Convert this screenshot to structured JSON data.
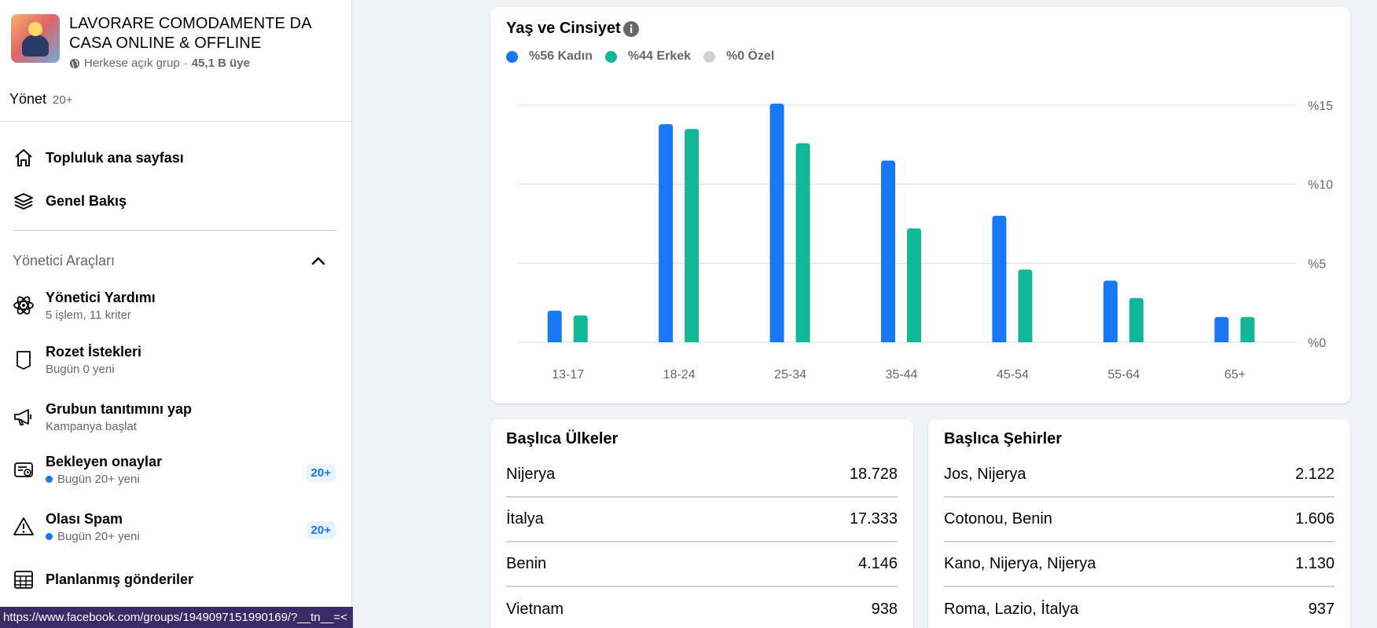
{
  "group": {
    "name": "LAVORARE COMODAMENTE DA CASA ONLINE & OFFLINE",
    "privacy": "Herkese açık grup",
    "separator": "·",
    "members": "45,1 B üye"
  },
  "manage": {
    "label": "Yönet",
    "count": "20+"
  },
  "nav": {
    "home": "Topluluk ana sayfası",
    "overview": "Genel Bakış"
  },
  "admin_tools": {
    "title": "Yönetici Araçları",
    "items": [
      {
        "title": "Yönetici Yardımı",
        "sub": "5 işlem, 11 kriter",
        "icon": "admin-assist-icon"
      },
      {
        "title": "Rozet İstekleri",
        "sub": "Bugün 0 yeni",
        "icon": "badge-icon"
      },
      {
        "title": "Grubun tanıtımını yap",
        "sub": "Kampanya başlat",
        "icon": "megaphone-icon"
      },
      {
        "title": "Bekleyen onaylar",
        "sub": "Bugün 20+ yeni",
        "badge": "20+",
        "icon": "pending-icon"
      },
      {
        "title": "Olası Spam",
        "sub": "Bugün 20+ yeni",
        "badge": "20+",
        "icon": "warning-icon"
      },
      {
        "title": "Planlanmış gönderiler",
        "icon": "calendar-icon"
      }
    ]
  },
  "status_url": "https://www.facebook.com/groups/1949097151990169/?__tn__=<",
  "chart": {
    "title": "Yaş ve Cinsiyet",
    "legend": [
      {
        "label": "%56 Kadın",
        "color": "#1877f2"
      },
      {
        "label": "%44 Erkek",
        "color": "#12b797"
      },
      {
        "label": "%0 Özel",
        "color": "#ced0d4"
      }
    ]
  },
  "chart_data": {
    "type": "bar",
    "title": "Yaş ve Cinsiyet",
    "categories": [
      "13-17",
      "18-24",
      "25-34",
      "35-44",
      "45-54",
      "55-64",
      "65+"
    ],
    "series": [
      {
        "name": "%56 Kadın",
        "color": "#1877f2",
        "values": [
          2.0,
          13.8,
          15.1,
          11.5,
          8.0,
          3.9,
          1.6
        ]
      },
      {
        "name": "%44 Erkek",
        "color": "#12b797",
        "values": [
          1.7,
          13.5,
          12.6,
          7.2,
          4.6,
          2.8,
          1.6
        ]
      }
    ],
    "yticks": [
      "%0",
      "%5",
      "%10",
      "%15"
    ],
    "ylim": [
      0,
      15
    ],
    "grid": true,
    "legend_position": "top-left"
  },
  "countries": {
    "title": "Başlıca Ülkeler",
    "rows": [
      {
        "name": "Nijerya",
        "value": "18.728"
      },
      {
        "name": "İtalya",
        "value": "17.333"
      },
      {
        "name": "Benin",
        "value": "4.146"
      },
      {
        "name": "Vietnam",
        "value": "938"
      }
    ]
  },
  "cities": {
    "title": "Başlıca Şehirler",
    "rows": [
      {
        "name": "Jos, Nijerya",
        "value": "2.122"
      },
      {
        "name": "Cotonou, Benin",
        "value": "1.606"
      },
      {
        "name": "Kano, Nijerya, Nijerya",
        "value": "1.130"
      },
      {
        "name": "Roma, Lazio, İtalya",
        "value": "937"
      }
    ]
  }
}
